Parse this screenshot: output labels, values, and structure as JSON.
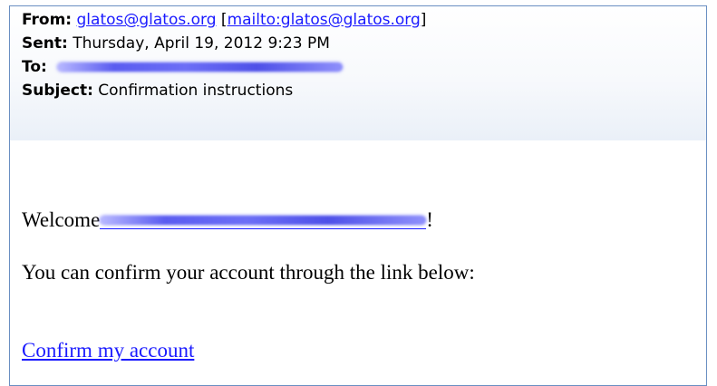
{
  "header": {
    "from_label": "From:",
    "from_email": "glatos@glatos.org",
    "from_mailto_open": "[",
    "from_mailto": "mailto:glatos@glatos.org",
    "from_mailto_close": "]",
    "sent_label": "Sent:",
    "sent_value": "Thursday, April 19, 2012 9:23 PM",
    "to_label": "To:",
    "subject_label": "Subject:",
    "subject_value": "Confirmation instructions"
  },
  "body": {
    "welcome_prefix": "Welcome",
    "welcome_suffix": "!",
    "instruction": "You can confirm your account through the link below:",
    "confirm_link": "Confirm my account"
  },
  "colors": {
    "link": "#1a1aff",
    "frame_border": "#6a8fc2",
    "redaction": "#5a5cf0"
  }
}
